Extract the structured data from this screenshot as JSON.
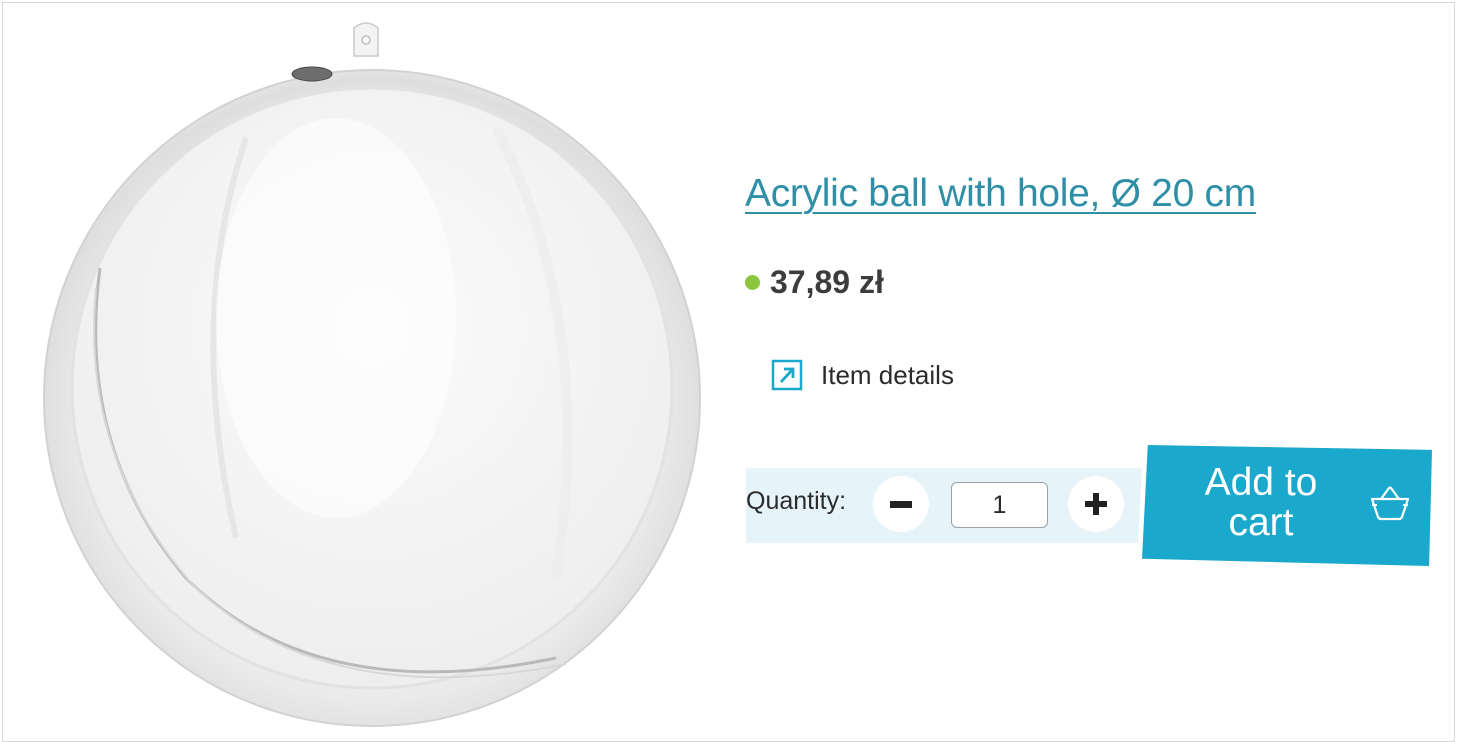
{
  "product": {
    "title": "Acrylic ball with hole, Ø 20 cm",
    "price": "37,89 zł",
    "availability_color": "#8cc63f",
    "image_icon": "acrylic-ball-image"
  },
  "details": {
    "label": "Item details",
    "icon": "external-link-icon"
  },
  "quantity": {
    "label": "Quantity:",
    "value": "1",
    "decrease_icon": "minus-icon",
    "increase_icon": "plus-icon"
  },
  "cart": {
    "label": "Add to cart",
    "icon": "basket-icon"
  },
  "colors": {
    "accent": "#1aa8cc",
    "link": "#2f8fa6",
    "panel": "#e6f4f9",
    "text": "#2b2b2b"
  }
}
